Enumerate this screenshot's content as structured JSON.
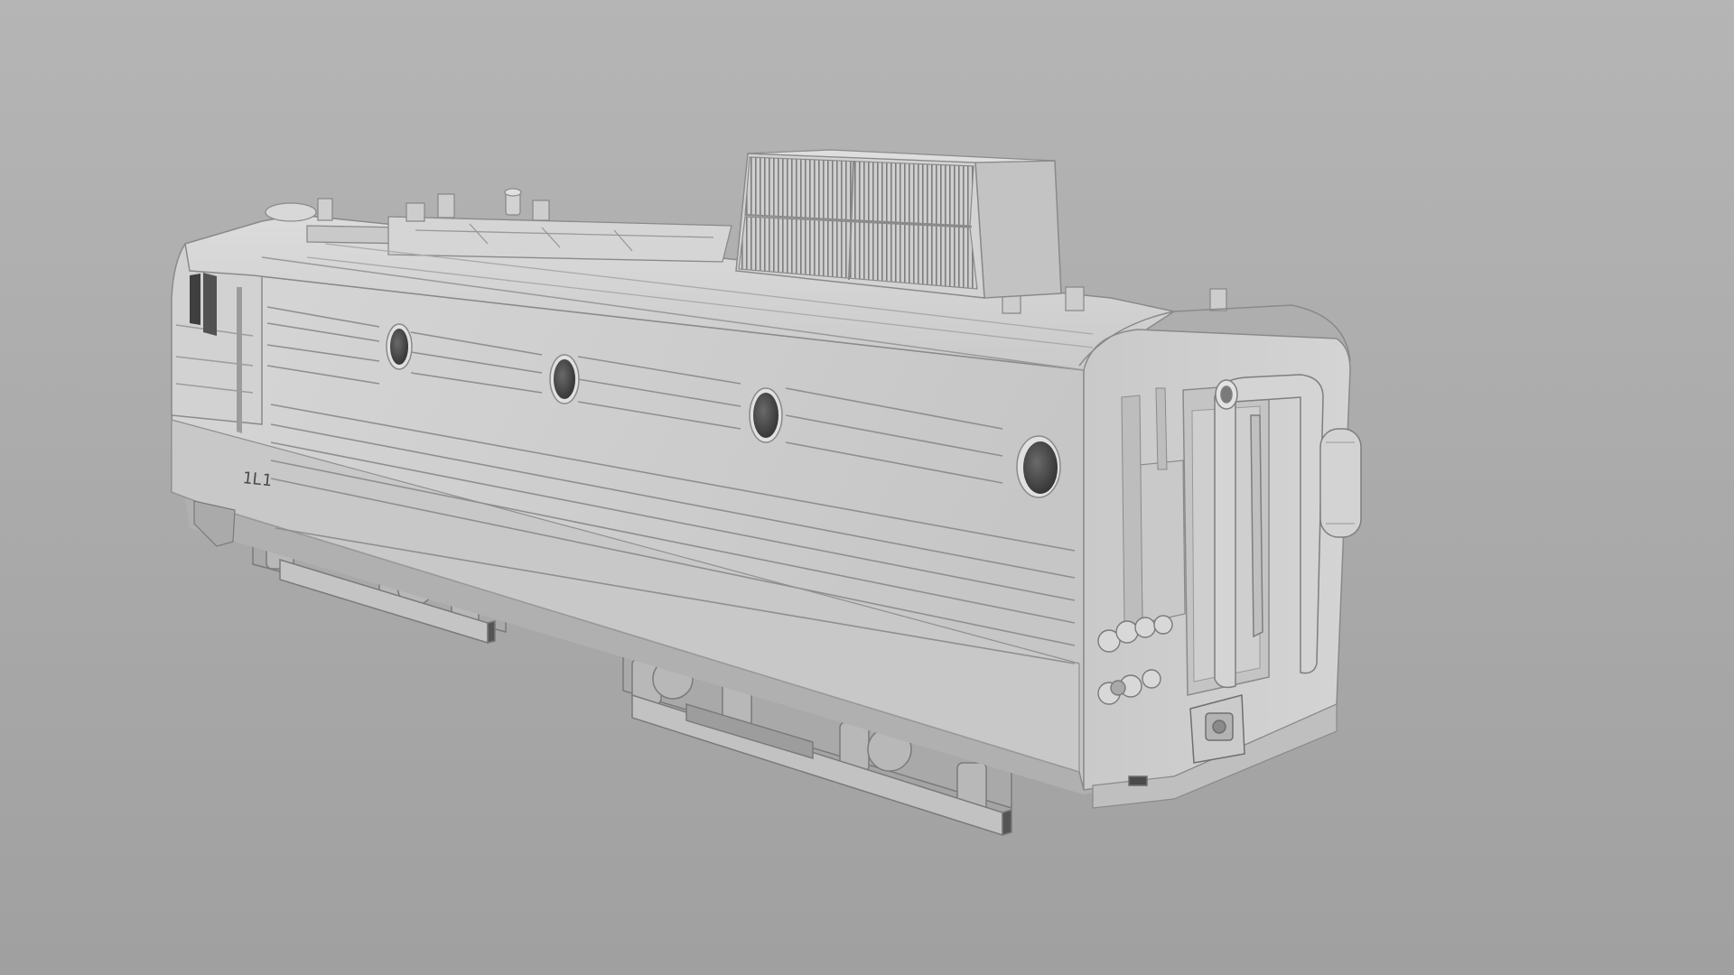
{
  "scene": {
    "background_top": "#b3b3b3",
    "background_bottom": "#a3a3a3",
    "model_body": "#cfcfcf",
    "model_side": "#c3c3c3",
    "model_shadow": "#8e8e8e",
    "model_dark": "#4a4a4a",
    "model_line": "#9b9b9b",
    "model_highlight": "#e2e2e2",
    "cab_marking": "1L1"
  }
}
